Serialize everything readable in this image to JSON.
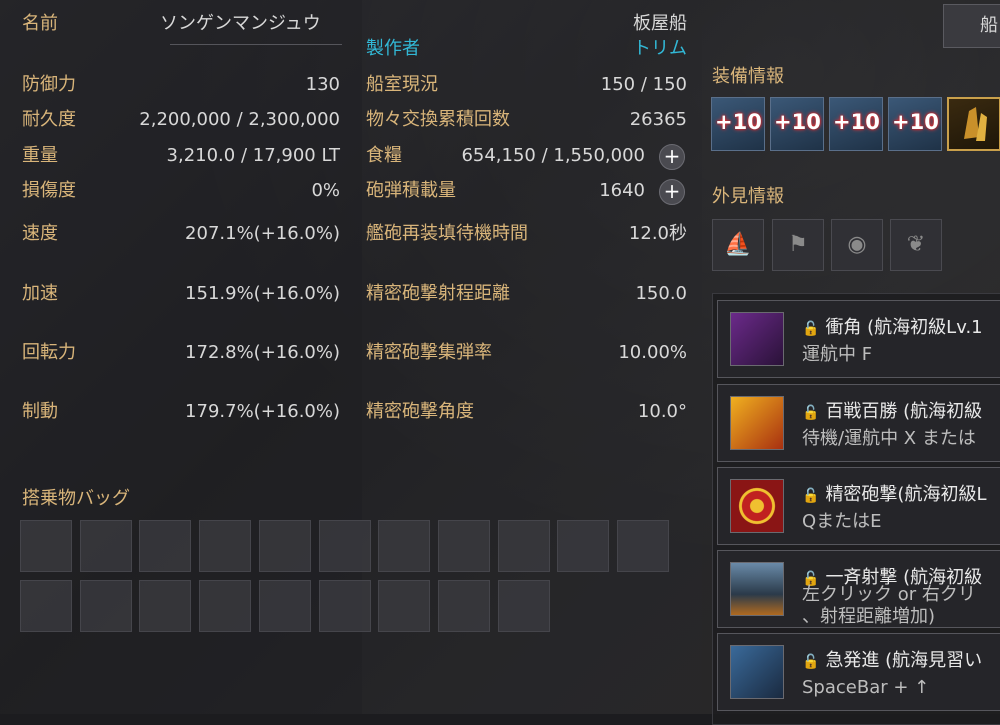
{
  "header": {
    "name_label": "名前",
    "name_value": "ソンゲンマンジュウ",
    "ship_type": "板屋船",
    "maker_label": "製作者",
    "maker_value": "トリム"
  },
  "stats_left": [
    {
      "label": "防御力",
      "value": "130"
    },
    {
      "label": "耐久度",
      "value": "2,200,000 / 2,300,000"
    },
    {
      "label": "重量",
      "value": "3,210.0 / 17,900 LT"
    },
    {
      "label": "損傷度",
      "value": "0%"
    },
    {
      "label": "速度",
      "value": "207.1%(+16.0%)"
    },
    {
      "label": "加速",
      "value": "151.9%(+16.0%)"
    },
    {
      "label": "回転力",
      "value": "172.8%(+16.0%)"
    },
    {
      "label": "制動",
      "value": "179.7%(+16.0%)"
    }
  ],
  "stats_right": [
    {
      "label": "船室現況",
      "value": "150 / 150"
    },
    {
      "label": "物々交換累積回数",
      "value": "26365"
    },
    {
      "label": "食糧",
      "value": "654,150 / 1,550,000"
    },
    {
      "label": "砲弾積載量",
      "value": "1640"
    },
    {
      "label": "艦砲再装填待機時間",
      "value": "12.0秒"
    },
    {
      "label": "精密砲撃射程距離",
      "value": "150.0"
    },
    {
      "label": "精密砲撃集弾率",
      "value": "10.00%"
    },
    {
      "label": "精密砲撃角度",
      "value": "10.0°"
    }
  ],
  "plus_button": "+",
  "cargo": {
    "title": "搭乗物バッグ"
  },
  "top_button": "船",
  "equipment": {
    "title": "装備情報",
    "slots": [
      "+10",
      "+10",
      "+10",
      "+10"
    ]
  },
  "appearance": {
    "title": "外見情報"
  },
  "skills": [
    {
      "name": "衝角 (航海初級Lv.1",
      "desc": "運航中 F"
    },
    {
      "name": "百戦百勝 (航海初級",
      "desc": "待機/運航中 X または"
    },
    {
      "name": "精密砲撃(航海初級L",
      "desc": "QまたはE"
    },
    {
      "name": "一斉射撃 (航海初級",
      "desc": "左クリック or 右クリ",
      "desc2": "、射程距離増加)"
    },
    {
      "name": "急発進 (航海見習い",
      "desc": "SpaceBar + ↑"
    }
  ],
  "colors": {
    "label_gold": "#d9b57a",
    "cyan": "#32b8d6",
    "plus10_glow": "#ff3a3a"
  }
}
